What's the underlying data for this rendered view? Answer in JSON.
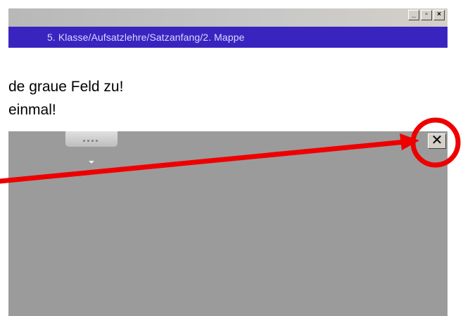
{
  "window": {
    "minimize_glyph": "_",
    "restore_glyph": "▫",
    "close_glyph": "×"
  },
  "path_bar": {
    "text": "5. Klasse/Aufsatzlehre/Satzanfang/2. Mappe"
  },
  "instructions": {
    "line1": "de graue Feld zu!",
    "line2": "einmal!"
  },
  "gray_field": {
    "close_button_glyph": "✕"
  },
  "icons": {
    "monitor": "monitor-icon",
    "dropdown": "chevron-down-icon",
    "close": "close-icon"
  },
  "colors": {
    "path_bar_bg": "#3a24c0",
    "gray_field_bg": "#9b9b9b",
    "annotation_red": "#ee0000"
  }
}
